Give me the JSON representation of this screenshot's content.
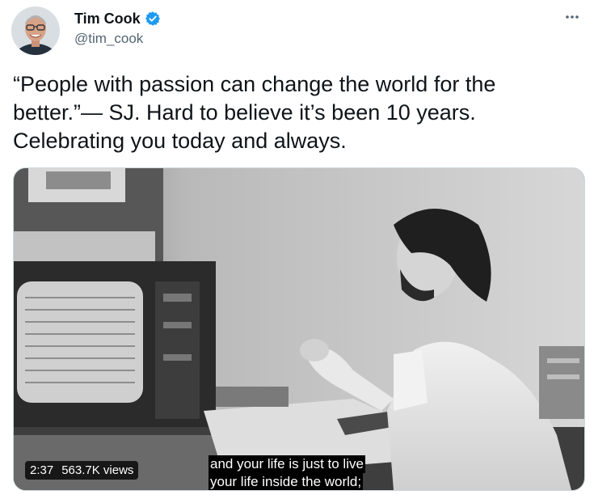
{
  "author": {
    "display_name": "Tim Cook",
    "handle": "@tim_cook",
    "verified": true,
    "verified_color": "#1d9bf0"
  },
  "menu": {
    "icon": "more-horizontal-icon"
  },
  "tweet": {
    "text": "“People with passion can change the world for the better.”— SJ. Hard to believe it’s been 10 years. Celebrating you today and always."
  },
  "media": {
    "type": "video",
    "duration": "2:37",
    "views": "563.7K views",
    "captions": [
      "and your life is just to live",
      "your life inside the world;"
    ]
  }
}
